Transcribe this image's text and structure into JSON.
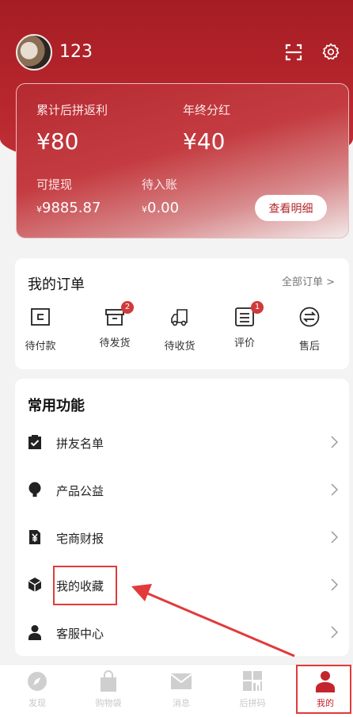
{
  "user": {
    "name": "123"
  },
  "earnings": {
    "rebate_label": "累计后拼返利",
    "rebate_value": "¥80",
    "dividend_label": "年终分红",
    "dividend_value": "¥40",
    "withdrawable_label": "可提现",
    "withdrawable_currency": "¥",
    "withdrawable_value": "9885.87",
    "pending_label": "待入账",
    "pending_currency": "¥",
    "pending_value": "0.00",
    "detail_button": "查看明细"
  },
  "orders": {
    "title": "我的订单",
    "all_link": "全部订单 >",
    "items": [
      {
        "label": "待付款",
        "icon": "wallet-icon"
      },
      {
        "label": "待发货",
        "icon": "box-icon",
        "badge": "2"
      },
      {
        "label": "待收货",
        "icon": "truck-icon"
      },
      {
        "label": "评价",
        "icon": "review-icon",
        "badge": "1"
      },
      {
        "label": "售后",
        "icon": "exchange-icon"
      }
    ]
  },
  "functions": {
    "title": "常用功能",
    "items": [
      {
        "label": "拼友名单",
        "icon": "clipboard-check-icon"
      },
      {
        "label": "产品公益",
        "icon": "lightbulb-icon"
      },
      {
        "label": "宅商财报",
        "icon": "yen-document-icon"
      },
      {
        "label": "我的收藏",
        "icon": "cube-icon"
      },
      {
        "label": "客服中心",
        "icon": "user-icon"
      }
    ]
  },
  "tabbar": {
    "items": [
      {
        "label": "发现",
        "icon": "compass-icon"
      },
      {
        "label": "购物袋",
        "icon": "shopping-bag-icon"
      },
      {
        "label": "消息",
        "icon": "mail-icon"
      },
      {
        "label": "后拼码",
        "icon": "qrcode-icon"
      },
      {
        "label": "我的",
        "icon": "profile-icon",
        "active": true
      }
    ]
  },
  "colors": {
    "brand": "#b4262c",
    "annotation": "#e23a3a"
  }
}
